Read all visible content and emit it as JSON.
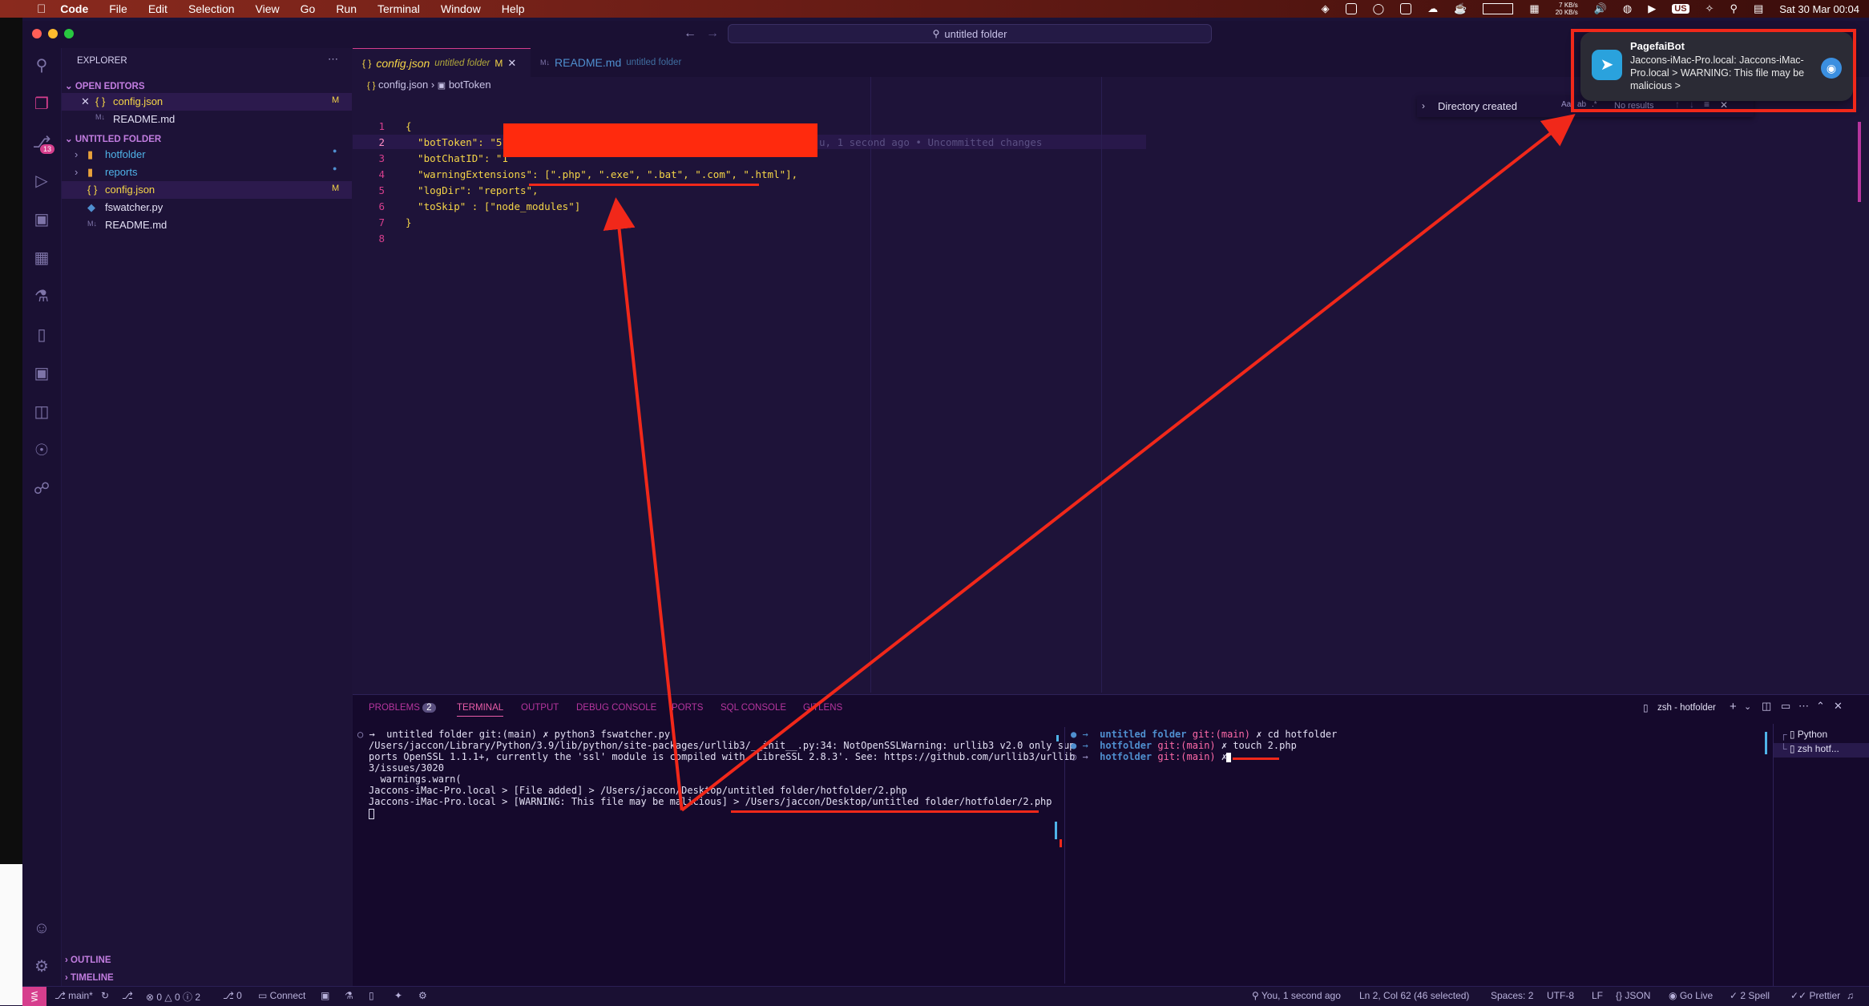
{
  "menubar": {
    "app": "Code",
    "items": [
      "File",
      "Edit",
      "Selection",
      "View",
      "Go",
      "Run",
      "Terminal",
      "Window",
      "Help"
    ],
    "net_up": "7 KB/s",
    "net_down": "20 KB/s",
    "input_source": "US",
    "datetime": "Sat 30 Mar  00:04"
  },
  "window": {
    "search_text": "untitled folder"
  },
  "activity": {
    "scm_badge": "13"
  },
  "sidebar": {
    "title": "EXPLORER",
    "open_editors_header": "OPEN EDITORS",
    "open_editors": [
      {
        "name": "config.json",
        "status": "M"
      },
      {
        "name": "README.md",
        "status": ""
      }
    ],
    "folder_header": "UNTITLED FOLDER",
    "tree": [
      {
        "name": "hotfolder",
        "type": "folder"
      },
      {
        "name": "reports",
        "type": "folder"
      },
      {
        "name": "config.json",
        "type": "json",
        "status": "M"
      },
      {
        "name": "fswatcher.py",
        "type": "py"
      },
      {
        "name": "README.md",
        "type": "md"
      }
    ],
    "outline_header": "OUTLINE",
    "timeline_header": "TIMELINE"
  },
  "tabs": [
    {
      "name": "config.json",
      "desc": "untitled folder",
      "status": "M"
    },
    {
      "name": "README.md",
      "desc": "untitled folder"
    }
  ],
  "breadcrumb": {
    "file": "config.json",
    "symbol": "botToken"
  },
  "editor": {
    "line_numbers": [
      "1",
      "2",
      "3",
      "4",
      "5",
      "6",
      "7",
      "8"
    ],
    "lines": [
      "{",
      "  \"botToken\": \"51",
      "  \"botChatID\": \"1",
      "  \"warningExtensions\": [\".php\", \".exe\", \".bat\", \".com\", \".html\"],",
      "  \"logDir\": \"reports\",",
      "  \"toSkip\" : [\"node_modules\"]",
      "}",
      ""
    ],
    "blame": "u, 1 second ago • Uncommitted changes"
  },
  "find_widget": {
    "section": "Directory created",
    "result": "No results"
  },
  "notification": {
    "title": "PagefaiBot",
    "body": "Jaccons-iMac-Pro.local: Jaccons-iMac-Pro.local > WARNING: This file may be malicious >"
  },
  "panel": {
    "tabs": [
      "PROBLEMS",
      "TERMINAL",
      "OUTPUT",
      "DEBUG CONSOLE",
      "PORTS",
      "SQL CONSOLE",
      "GITLENS"
    ],
    "problems_count": "2",
    "terminal_name": "zsh - hotfolder",
    "term_list": [
      "Python",
      "zsh hotf..."
    ],
    "left_terminal": [
      "→  untitled folder git:(main) ✗ python3 fswatcher.py",
      "/Users/jaccon/Library/Python/3.9/lib/python/site-packages/urllib3/__init__.py:34: NotOpenSSLWarning: urllib3 v2.0 only sup",
      "ports OpenSSL 1.1.1+, currently the 'ssl' module is compiled with 'LibreSSL 2.8.3'. See: https://github.com/urllib3/urllib",
      "3/issues/3020",
      "  warnings.warn(",
      "Jaccons-iMac-Pro.local > [File added] > /Users/jaccon/Desktop/untitled folder/hotfolder/2.php",
      "Jaccons-iMac-Pro.local > [WARNING: This file may be malicious] > /Users/jaccon/Desktop/untitled folder/hotfolder/2.php"
    ],
    "right_terminal": [
      {
        "dir": "untitled folder",
        "git": "git:(main)",
        "cmd": "✗ cd hotfolder"
      },
      {
        "dir": "hotfolder",
        "git": "git:(main)",
        "cmd": "✗ touch 2.php"
      },
      {
        "dir": "hotfolder",
        "git": "git:(main)",
        "cmd": "✗"
      }
    ]
  },
  "statusbar": {
    "branch": "main*",
    "errors": "0",
    "warnings": "0",
    "infos": "2",
    "ports": "0",
    "connect": "Connect",
    "blame": "You, 1 second ago",
    "position": "Ln 2, Col 62 (46 selected)",
    "spaces": "Spaces: 2",
    "encoding": "UTF-8",
    "eol": "LF",
    "language": "JSON",
    "golive": "Go Live",
    "spell": "2 Spell",
    "prettier": "Prettier"
  },
  "colors": {
    "accent_pink": "#d63e8d",
    "annotation_red": "#f1281a",
    "string_color": "#f5d547"
  }
}
